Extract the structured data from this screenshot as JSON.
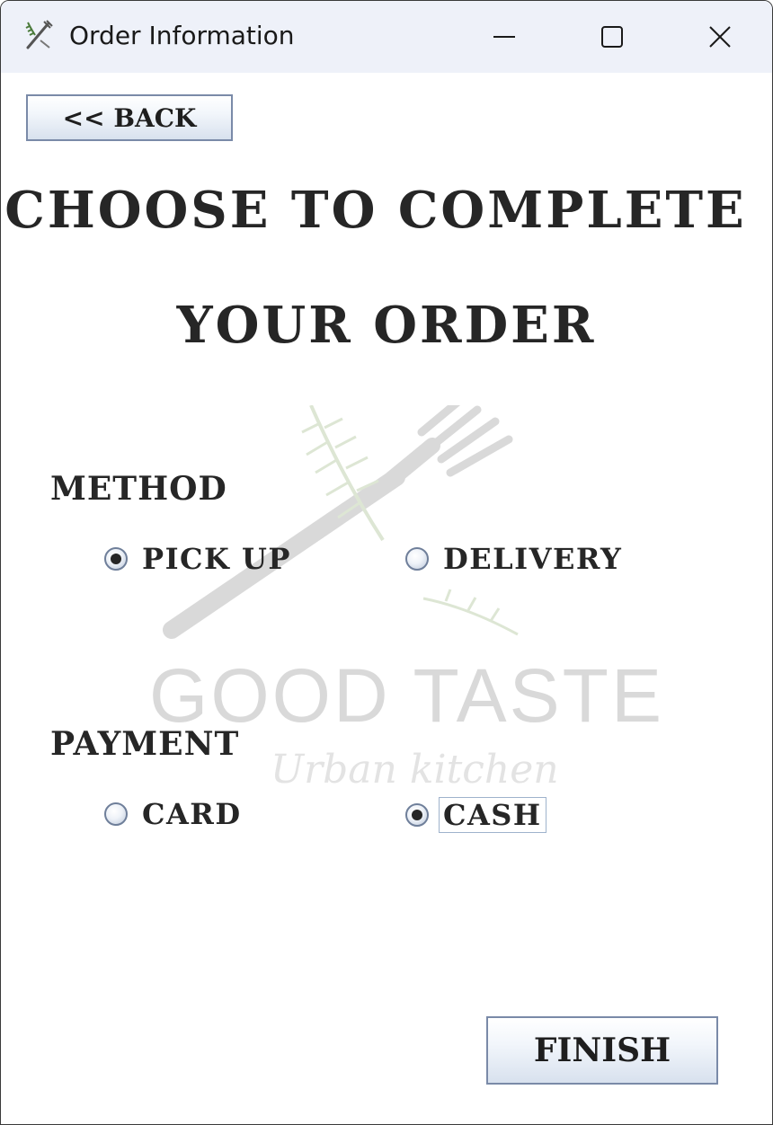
{
  "window": {
    "title": "Order Information",
    "app_icon": "fork-knife-icon",
    "controls": [
      "minimize-icon",
      "maximize-icon",
      "close-icon"
    ]
  },
  "toolbar": {
    "back_label": "<< BACK"
  },
  "heading": {
    "line1": "CHOOSE TO COMPLETE",
    "line2": "YOUR ORDER"
  },
  "watermark": {
    "brand": "GOOD TASTE",
    "tagline": "Urban kitchen"
  },
  "method": {
    "label": "METHOD",
    "options": [
      {
        "label": "PICK UP",
        "selected": true
      },
      {
        "label": "DELIVERY",
        "selected": false
      }
    ]
  },
  "payment": {
    "label": "PAYMENT",
    "options": [
      {
        "label": "CARD",
        "selected": false
      },
      {
        "label": "CASH",
        "selected": true,
        "focused": true
      }
    ]
  },
  "footer": {
    "finish_label": "FINISH"
  },
  "colors": {
    "titlebar": "#eef1f9",
    "text": "#262626",
    "button_border": "#7a8aa8",
    "watermark": "#d9d9d9"
  }
}
